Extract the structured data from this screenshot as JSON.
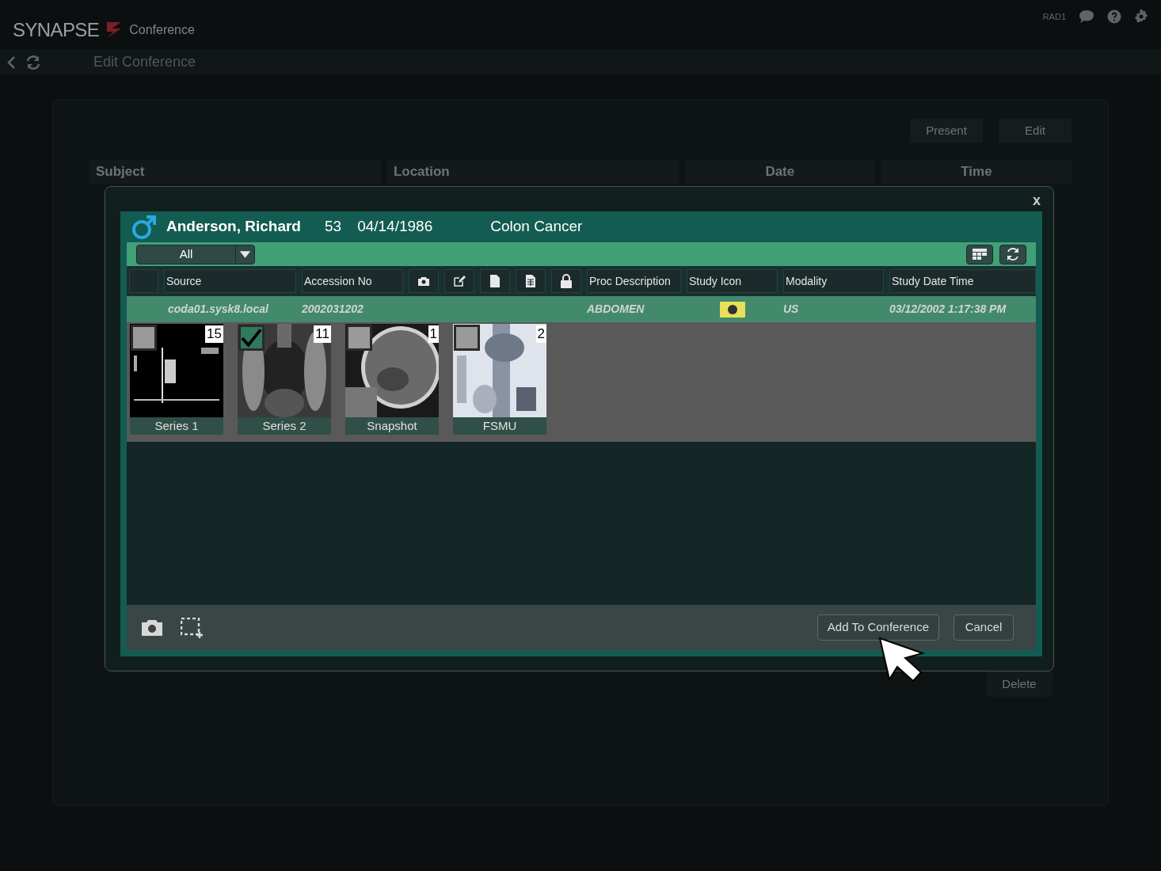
{
  "app": {
    "brand": "SYNAPSE",
    "module": "Conference",
    "user": "RAD1"
  },
  "toolbar": {
    "title": "Edit Conference"
  },
  "background": {
    "buttons": [
      "Present",
      "Edit"
    ],
    "columns": [
      "Subject",
      "Location",
      "Date",
      "Time"
    ],
    "delete_button": "Delete"
  },
  "dialog": {
    "close": "x",
    "patient": {
      "name": "Anderson, Richard",
      "age": "53",
      "dob": "04/14/1986",
      "diagnosis": "Colon Cancer"
    },
    "filter": {
      "value": "All"
    },
    "columns": [
      {
        "kind": "blank"
      },
      {
        "kind": "text",
        "label": "Source"
      },
      {
        "kind": "text",
        "label": "Accession No"
      },
      {
        "kind": "camera"
      },
      {
        "kind": "edit"
      },
      {
        "kind": "file"
      },
      {
        "kind": "report"
      },
      {
        "kind": "lock"
      },
      {
        "kind": "text",
        "label": "Proc Description"
      },
      {
        "kind": "text",
        "label": "Study Icon"
      },
      {
        "kind": "text",
        "label": "Modality"
      },
      {
        "kind": "text",
        "label": "Study Date Time"
      }
    ],
    "study": {
      "source": "coda01.sysk8.local",
      "accession": "2002031202",
      "proc": "ABDOMEN",
      "modality": "US",
      "datetime": "03/12/2002 1:17:38 PM"
    },
    "series": [
      {
        "label": "Series 1",
        "count": "15",
        "checked": false,
        "kind": "dark"
      },
      {
        "label": "Series 2",
        "count": "11",
        "checked": true,
        "kind": "chest"
      },
      {
        "label": "Snapshot",
        "count": "1",
        "checked": false,
        "kind": "brain"
      },
      {
        "label": "FSMU",
        "count": "2",
        "checked": false,
        "kind": "xray"
      }
    ],
    "buttons": [
      "Add To Conference",
      "Cancel"
    ]
  }
}
